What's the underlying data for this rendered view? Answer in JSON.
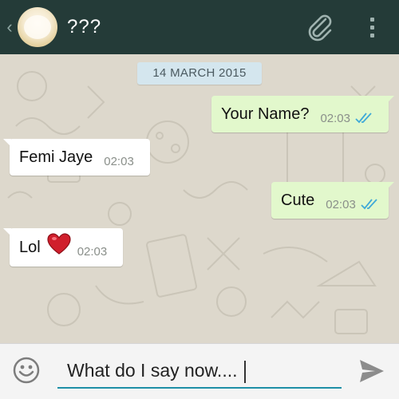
{
  "header": {
    "back_icon": "chevron-left-icon",
    "contact_name": "???",
    "attach_icon": "paperclip-icon",
    "menu_icon": "more-vertical-icon",
    "bg_color": "#243b38"
  },
  "chat": {
    "date_label": "14 MARCH 2015",
    "messages": [
      {
        "direction": "outgoing",
        "text": "Your Name?",
        "time": "02:03",
        "status": "read"
      },
      {
        "direction": "incoming",
        "text": "Femi Jaye",
        "time": "02:03"
      },
      {
        "direction": "outgoing",
        "text": "Cute",
        "time": "02:03",
        "status": "read"
      },
      {
        "direction": "incoming",
        "text": "Lol",
        "emoji": "heart-icon",
        "time": "02:03"
      }
    ],
    "outgoing_bubble_color": "#e2f8cc",
    "incoming_bubble_color": "#ffffff",
    "read_tick_color": "#3fa9d8"
  },
  "composer": {
    "emoji_icon": "smiley-icon",
    "input_value": "What do I say now....",
    "send_icon": "send-icon",
    "accent_color": "#1e8fa6"
  }
}
